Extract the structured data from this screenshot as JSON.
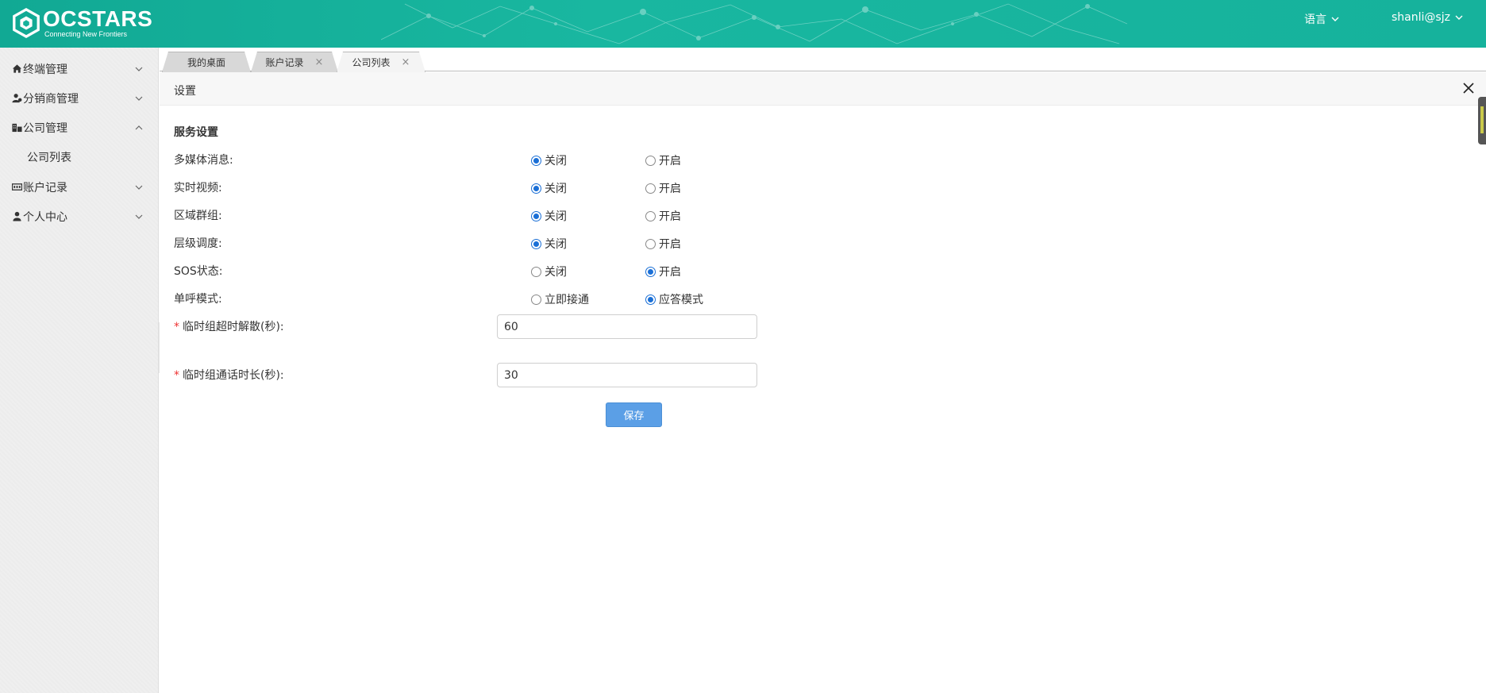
{
  "header": {
    "logo_title": "OCSTARS",
    "logo_subtitle": "Connecting New Frontiers",
    "language_menu": "语言",
    "user_menu": "shanli@sjz",
    "colors": {
      "header_bg": "#16b29c"
    }
  },
  "sidebar": {
    "items": [
      {
        "label": "终端管理",
        "icon": "home-icon",
        "expanded": false
      },
      {
        "label": "分销商管理",
        "icon": "users-icon",
        "expanded": false
      },
      {
        "label": "公司管理",
        "icon": "building-icon",
        "expanded": true,
        "children": [
          {
            "label": "公司列表"
          }
        ]
      },
      {
        "label": "账户记录",
        "icon": "card-icon",
        "expanded": false
      },
      {
        "label": "个人中心",
        "icon": "user-icon",
        "expanded": false
      }
    ]
  },
  "tabs": [
    {
      "label": "我的桌面",
      "closable": false
    },
    {
      "label": "账户记录",
      "closable": true,
      "close": "×"
    },
    {
      "label": "公司列表",
      "closable": true,
      "close": "×",
      "active": true
    }
  ],
  "panel": {
    "title": "设置",
    "section_title": "服务设置",
    "rows": [
      {
        "label": "多媒体消息:",
        "options": [
          "关闭",
          "开启"
        ],
        "selected": 0
      },
      {
        "label": "实时视频:",
        "options": [
          "关闭",
          "开启"
        ],
        "selected": 0
      },
      {
        "label": "区域群组:",
        "options": [
          "关闭",
          "开启"
        ],
        "selected": 0
      },
      {
        "label": "层级调度:",
        "options": [
          "关闭",
          "开启"
        ],
        "selected": 0
      },
      {
        "label": "SOS状态:",
        "options": [
          "关闭",
          "开启"
        ],
        "selected": 1
      },
      {
        "label": "单呼模式:",
        "options": [
          "立即接通",
          "应答模式"
        ],
        "selected": 1
      }
    ],
    "fields": [
      {
        "required_mark": "*",
        "label": "临时组超时解散(秒):",
        "value": "60"
      },
      {
        "required_mark": "*",
        "label": "临时组通话时长(秒):",
        "value": "30"
      }
    ],
    "save_label": "保存",
    "colors": {
      "radio_on": "#1a6fd6",
      "save_bg": "#5b9fe6",
      "required": "#e33333"
    }
  }
}
